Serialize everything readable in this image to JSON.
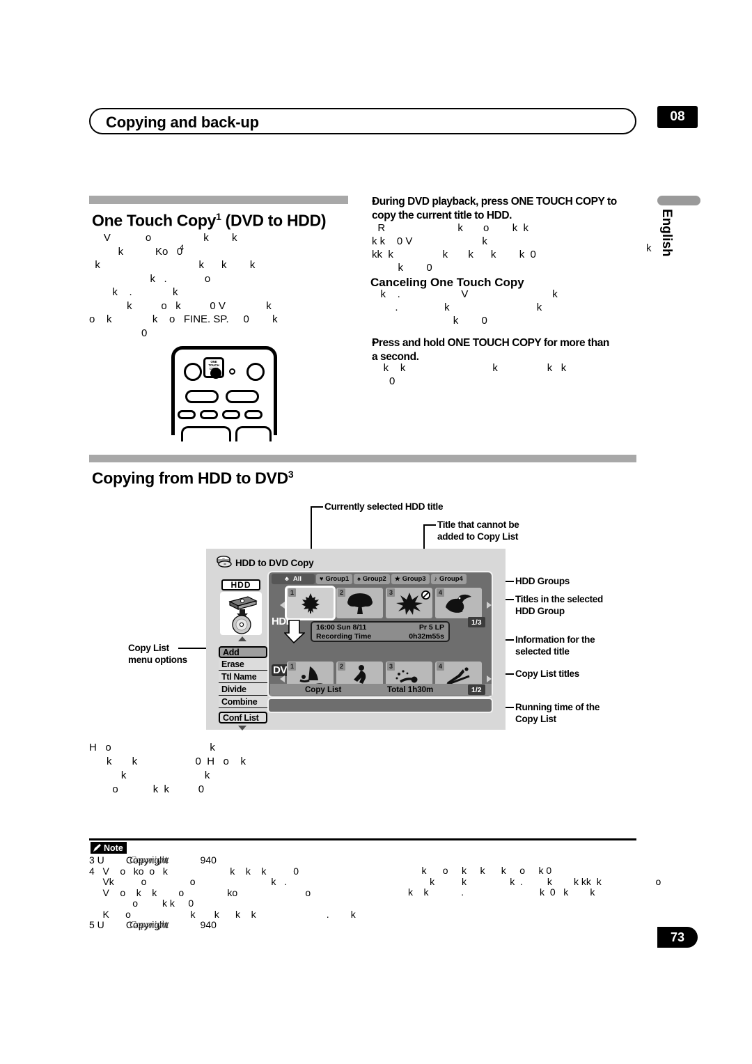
{
  "header": {
    "title": "Copying and back-up",
    "chapter": "08",
    "language_tab": "English",
    "page_number": "73"
  },
  "sections": {
    "one_touch": {
      "title": "One Touch Copy",
      "title_sup": "1",
      "title_tail": " (DVD to HDD)"
    },
    "hdd_to_dvd": {
      "title": "Copying from HDD to DVD",
      "title_sup": "3"
    },
    "canceling": {
      "title": "Canceling One Touch Copy"
    }
  },
  "bullets": {
    "during_playback": {
      "marker": "•",
      "line1": "During DVD playback, press ONE TOUCH COPY to",
      "line2": "copy the current title to HDD."
    },
    "press_and_hold": {
      "marker": "•",
      "line1": "Press and hold ONE TOUCH COPY for more than",
      "line2": "a second."
    }
  },
  "remote": {
    "button_label_line1": "ONE TOUCH",
    "button_label_line2": "COPY"
  },
  "osd": {
    "title": "HDD to DVD Copy",
    "title_icon": "disc-stack-icon",
    "device_label": "HDD",
    "group_tabs": [
      {
        "label": "All",
        "suit": "♣",
        "active": true
      },
      {
        "label": "Group1",
        "suit": "♥",
        "active": false
      },
      {
        "label": "Group2",
        "suit": "♠",
        "active": false
      },
      {
        "label": "Group3",
        "suit": "★",
        "active": false
      },
      {
        "label": "Group4",
        "suit": "♪",
        "active": false
      }
    ],
    "menu_options": [
      {
        "label": "Add",
        "state": "active"
      },
      {
        "label": "Erase",
        "state": "normal"
      },
      {
        "label": "Ttl Name",
        "state": "normal"
      },
      {
        "label": "Divide",
        "state": "normal"
      },
      {
        "label": "Combine",
        "state": "normal"
      },
      {
        "label": "Conf List",
        "state": "boxed"
      }
    ],
    "hdd_row": {
      "label": "HDD",
      "page_indicator": "1/3",
      "titles": [
        {
          "num": "1",
          "icon": "maple-leaf-icon",
          "selected": true,
          "blocked": false
        },
        {
          "num": "2",
          "icon": "tree-icon",
          "selected": false,
          "blocked": false
        },
        {
          "num": "3",
          "icon": "flower-icon",
          "selected": false,
          "blocked": true
        },
        {
          "num": "4",
          "icon": "toucan-bird-icon",
          "selected": false,
          "blocked": false
        }
      ]
    },
    "info_bar": {
      "time": "16:00 Sun  8/11",
      "program": "Pr 5  LP",
      "rec_label": "Recording Time",
      "rec_value": "0h32m55s"
    },
    "dvd_row": {
      "label": "DVD",
      "page_indicator": "1/2",
      "titles": [
        {
          "num": "1",
          "icon": "windsurfing-icon",
          "selected": false,
          "blocked": false
        },
        {
          "num": "2",
          "icon": "skating-icon",
          "selected": false,
          "blocked": false
        },
        {
          "num": "3",
          "icon": "swimming-icon",
          "selected": false,
          "blocked": false
        },
        {
          "num": "4",
          "icon": "ski-jump-icon",
          "selected": false,
          "blocked": false
        }
      ]
    },
    "copy_list_bar": {
      "label": "Copy List",
      "total_label": "Total  1h30m"
    }
  },
  "callouts": {
    "currently_selected": "Currently selected HDD title",
    "cannot_add_l1": "Title that cannot be",
    "cannot_add_l2": "added to Copy List",
    "copy_list_menu_l1": "Copy List",
    "copy_list_menu_l2": "menu options",
    "hdd_groups": "HDD Groups",
    "titles_selected_l1": "Titles in the selected",
    "titles_selected_l2": "HDD Group",
    "info_selected_l1": "Information for the",
    "info_selected_l2": "selected title",
    "copy_list_titles": "Copy List titles",
    "running_time_l1": "Running time of the",
    "running_time_l2": "Copy List"
  },
  "note": {
    "tag_label": "Note",
    "tag_icon": "pencil-icon",
    "items": [
      {
        "num": "3",
        "italic": "Copyright",
        "value": "940"
      },
      {
        "num": "4",
        "italic": "",
        "value": ""
      },
      {
        "num": "5",
        "italic": "Copyright",
        "value": "940"
      }
    ]
  },
  "degraded_text": {
    "left_col_one_touch": [
      "     V            o                  k        k",
      "          k           Ko   0",
      "  k                                  k      k        k",
      "                     k   .             o",
      "        k    .              k",
      "             k          o   k          0 V              k",
      "o    k              k    o   FINE. SP.     0        k",
      "                  0"
    ],
    "right_col_during": [
      "  R                         k       o        k  k",
      "k k    0 V                        k",
      "kk  k                 k       k      k        k  0",
      "         k        0"
    ],
    "right_col_cancel": [
      "   k    .                     V                             k",
      "        .                k                              k",
      "                            k        0"
    ],
    "right_col_hold": [
      "    k    k                              k                 k   k",
      "      0"
    ],
    "below_osd": [
      "H   o                                  k",
      "      k       k                    0  H   o    k",
      "           k                           k",
      "        o            k  k          0"
    ],
    "note_lines": [
      "3 U        Copyright            940",
      "4   V    o   ko  o   k                       k    k    k          0",
      "     Vk          o                o                            k   .",
      "     V    o    k    k        o                ko                         o",
      "                o         k k     0",
      "     K      o                      k       k      k    k                          .        k",
      "5 U        Copyright            940"
    ],
    "note_right_lines": [
      "     k      o     k     k      k     o     k 0",
      "        k          k                k  .         k        k kk  k                    o",
      "k    k            .                            k  0   k        k"
    ]
  }
}
